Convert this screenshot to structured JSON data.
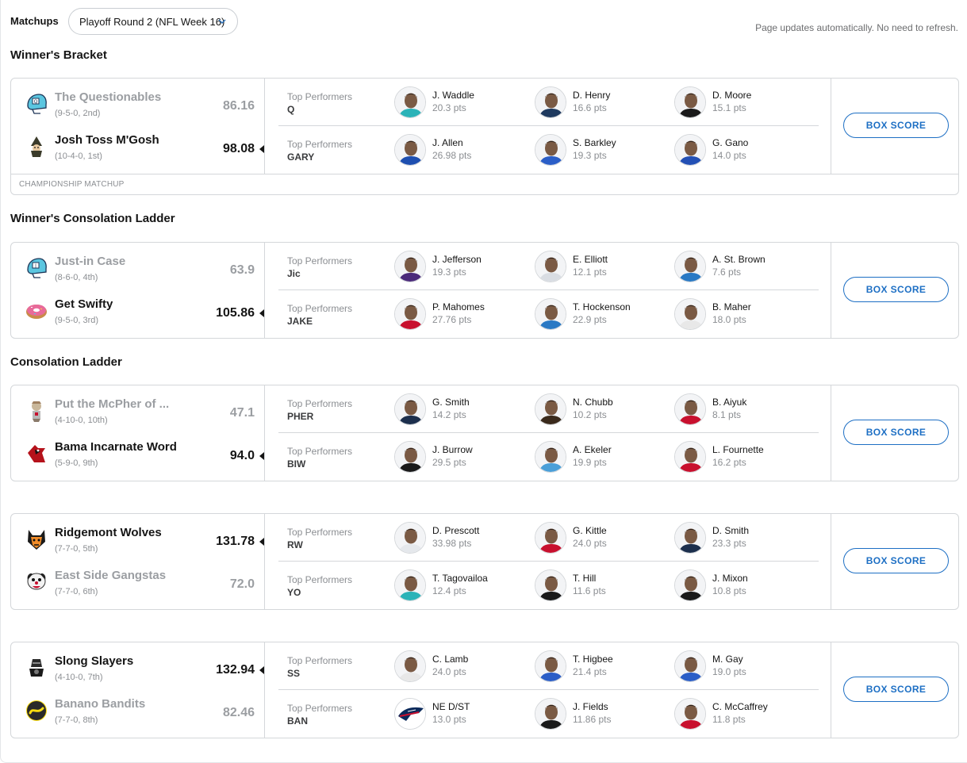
{
  "header": {
    "matchups_label": "Matchups",
    "week_selected": "Playoff Round 2 (NFL Week 16)",
    "refresh_note": "Page updates automatically. No need to refresh."
  },
  "sections": {
    "winners_bracket": "Winner's Bracket",
    "winners_consolation": "Winner's Consolation Ladder",
    "consolation": "Consolation Ladder"
  },
  "labels": {
    "top_performers": "Top Performers",
    "box_score": "BOX SCORE",
    "championship_matchup": "CHAMPIONSHIP MATCHUP"
  },
  "colors": {
    "accent": "#1d6fc4",
    "winner_text": "#151515",
    "loser_text": "#9b9ea2"
  },
  "matchups": [
    {
      "teams": [
        {
          "name": "The Questionables",
          "record": "(9-5-0, 2nd)",
          "score": "86.16",
          "winner": false,
          "logo": "helmet-q-icon"
        },
        {
          "name": "Josh Toss M'Gosh",
          "record": "(10-4-0, 1st)",
          "score": "98.08",
          "winner": true,
          "logo": "gnome-icon"
        }
      ],
      "performers": [
        {
          "abbr": "Q",
          "players": [
            {
              "name": "J. Waddle",
              "pts": "20.3 pts",
              "jersey": "#2bb3b8"
            },
            {
              "name": "D. Henry",
              "pts": "16.6 pts",
              "jersey": "#1f3a5f"
            },
            {
              "name": "D. Moore",
              "pts": "15.1 pts",
              "jersey": "#1a1a1a"
            }
          ]
        },
        {
          "abbr": "GARY",
          "players": [
            {
              "name": "J. Allen",
              "pts": "26.98 pts",
              "jersey": "#1e4fb0"
            },
            {
              "name": "S. Barkley",
              "pts": "19.3 pts",
              "jersey": "#2b5ec7"
            },
            {
              "name": "G. Gano",
              "pts": "14.0 pts",
              "jersey": "#2350b5"
            }
          ]
        }
      ],
      "footer": "CHAMPIONSHIP MATCHUP"
    },
    {
      "teams": [
        {
          "name": "Just-in Case",
          "record": "(8-6-0, 4th)",
          "score": "63.9",
          "winner": false,
          "logo": "helmet-j-icon"
        },
        {
          "name": "Get Swifty",
          "record": "(9-5-0, 3rd)",
          "score": "105.86",
          "winner": true,
          "logo": "donut-icon"
        }
      ],
      "performers": [
        {
          "abbr": "Jic",
          "players": [
            {
              "name": "J. Jefferson",
              "pts": "19.3 pts",
              "jersey": "#4b2a7a"
            },
            {
              "name": "E. Elliott",
              "pts": "12.1 pts",
              "jersey": "#d9dde3"
            },
            {
              "name": "A. St. Brown",
              "pts": "7.6 pts",
              "jersey": "#2a79c4"
            }
          ]
        },
        {
          "abbr": "JAKE",
          "players": [
            {
              "name": "P. Mahomes",
              "pts": "27.76 pts",
              "jersey": "#c8102e"
            },
            {
              "name": "T. Hockenson",
              "pts": "22.9 pts",
              "jersey": "#2a79c4"
            },
            {
              "name": "B. Maher",
              "pts": "18.0 pts",
              "jersey": "#e8e8e8"
            }
          ]
        }
      ]
    },
    {
      "teams": [
        {
          "name": "Put the McPher of ...",
          "record": "(4-10-0, 10th)",
          "score": "47.1",
          "winner": false,
          "logo": "mcgruff-icon"
        },
        {
          "name": "Bama Incarnate Word",
          "record": "(5-9-0, 9th)",
          "score": "94.0",
          "winner": true,
          "logo": "cardinal-icon"
        }
      ],
      "performers": [
        {
          "abbr": "PHER",
          "players": [
            {
              "name": "G. Smith",
              "pts": "14.2 pts",
              "jersey": "#1c2f4d"
            },
            {
              "name": "N. Chubb",
              "pts": "10.2 pts",
              "jersey": "#3a2a1c"
            },
            {
              "name": "B. Aiyuk",
              "pts": "8.1 pts",
              "jersey": "#c8102e"
            }
          ]
        },
        {
          "abbr": "BIW",
          "players": [
            {
              "name": "J. Burrow",
              "pts": "29.5 pts",
              "jersey": "#1a1a1a"
            },
            {
              "name": "A. Ekeler",
              "pts": "19.9 pts",
              "jersey": "#4a9fd8"
            },
            {
              "name": "L. Fournette",
              "pts": "16.2 pts",
              "jersey": "#c8102e"
            }
          ]
        }
      ]
    },
    {
      "teams": [
        {
          "name": "Ridgemont Wolves",
          "record": "(7-7-0, 5th)",
          "score": "131.78",
          "winner": true,
          "logo": "wolf-icon"
        },
        {
          "name": "East Side Gangstas",
          "record": "(7-7-0, 6th)",
          "score": "72.0",
          "winner": false,
          "logo": "clown-icon"
        }
      ],
      "performers": [
        {
          "abbr": "RW",
          "players": [
            {
              "name": "D. Prescott",
              "pts": "33.98 pts",
              "jersey": "#e5e8ec"
            },
            {
              "name": "G. Kittle",
              "pts": "24.0 pts",
              "jersey": "#c8102e"
            },
            {
              "name": "D. Smith",
              "pts": "23.3 pts",
              "jersey": "#1c2f4d"
            }
          ]
        },
        {
          "abbr": "YO",
          "players": [
            {
              "name": "T. Tagovailoa",
              "pts": "12.4 pts",
              "jersey": "#2bb3b8"
            },
            {
              "name": "T. Hill",
              "pts": "11.6 pts",
              "jersey": "#1a1a1a"
            },
            {
              "name": "J. Mixon",
              "pts": "10.8 pts",
              "jersey": "#1a1a1a"
            }
          ]
        }
      ]
    },
    {
      "teams": [
        {
          "name": "Slong Slayers",
          "record": "(4-10-0, 7th)",
          "score": "132.94",
          "winner": true,
          "logo": "knight-icon"
        },
        {
          "name": "Banano Bandits",
          "record": "(7-7-0, 8th)",
          "score": "82.46",
          "winner": false,
          "logo": "banano-icon"
        }
      ],
      "performers": [
        {
          "abbr": "SS",
          "players": [
            {
              "name": "C. Lamb",
              "pts": "24.0 pts",
              "jersey": "#e8e8e8"
            },
            {
              "name": "T. Higbee",
              "pts": "21.4 pts",
              "jersey": "#2b5ec7"
            },
            {
              "name": "M. Gay",
              "pts": "19.0 pts",
              "jersey": "#2b5ec7"
            }
          ]
        },
        {
          "abbr": "BAN",
          "players": [
            {
              "name": "NE D/ST",
              "pts": "13.0 pts",
              "jersey": "team-logo"
            },
            {
              "name": "J. Fields",
              "pts": "11.86 pts",
              "jersey": "#1a1a1a"
            },
            {
              "name": "C. McCaffrey",
              "pts": "11.8 pts",
              "jersey": "#c8102e"
            }
          ]
        }
      ]
    }
  ]
}
